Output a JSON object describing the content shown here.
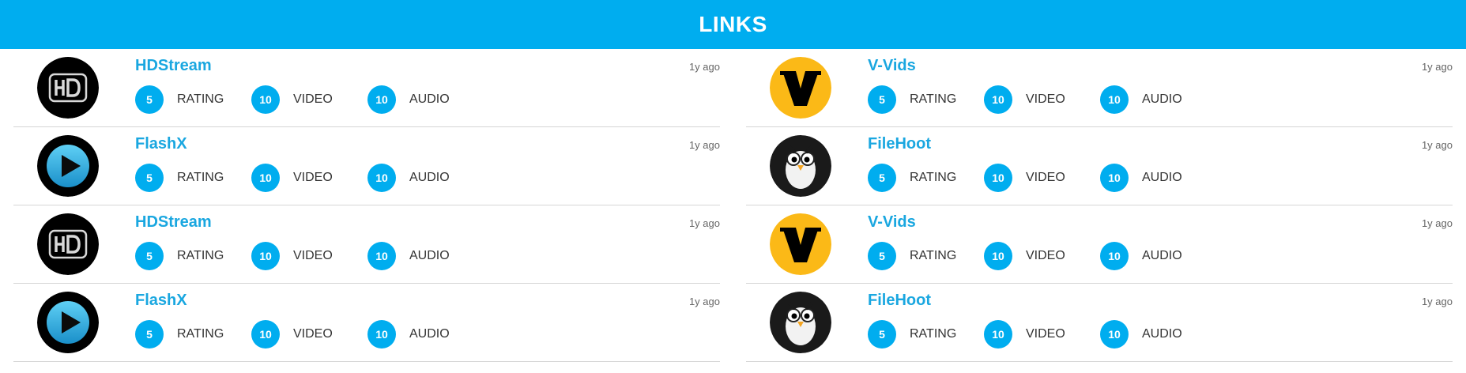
{
  "header": {
    "title": "LINKS"
  },
  "labels": {
    "rating": "RATING",
    "video": "VIDEO",
    "audio": "AUDIO"
  },
  "colors": {
    "accent": "#00adef",
    "link": "#1aa7e0",
    "divider": "#d6d6d6"
  },
  "columns": [
    {
      "rows": [
        {
          "name": "HDStream",
          "icon": "hd-icon",
          "time": "1y ago",
          "rating": "5",
          "video": "10",
          "audio": "10"
        },
        {
          "name": "FlashX",
          "icon": "play-icon",
          "time": "1y ago",
          "rating": "5",
          "video": "10",
          "audio": "10"
        },
        {
          "name": "HDStream",
          "icon": "hd-icon",
          "time": "1y ago",
          "rating": "5",
          "video": "10",
          "audio": "10"
        },
        {
          "name": "FlashX",
          "icon": "play-icon",
          "time": "1y ago",
          "rating": "5",
          "video": "10",
          "audio": "10"
        }
      ]
    },
    {
      "rows": [
        {
          "name": "V-Vids",
          "icon": "v-letter-icon",
          "time": "1y ago",
          "rating": "5",
          "video": "10",
          "audio": "10"
        },
        {
          "name": "FileHoot",
          "icon": "owl-icon",
          "time": "1y ago",
          "rating": "5",
          "video": "10",
          "audio": "10"
        },
        {
          "name": "V-Vids",
          "icon": "v-letter-icon",
          "time": "1y ago",
          "rating": "5",
          "video": "10",
          "audio": "10"
        },
        {
          "name": "FileHoot",
          "icon": "owl-icon",
          "time": "1y ago",
          "rating": "5",
          "video": "10",
          "audio": "10"
        }
      ]
    }
  ]
}
